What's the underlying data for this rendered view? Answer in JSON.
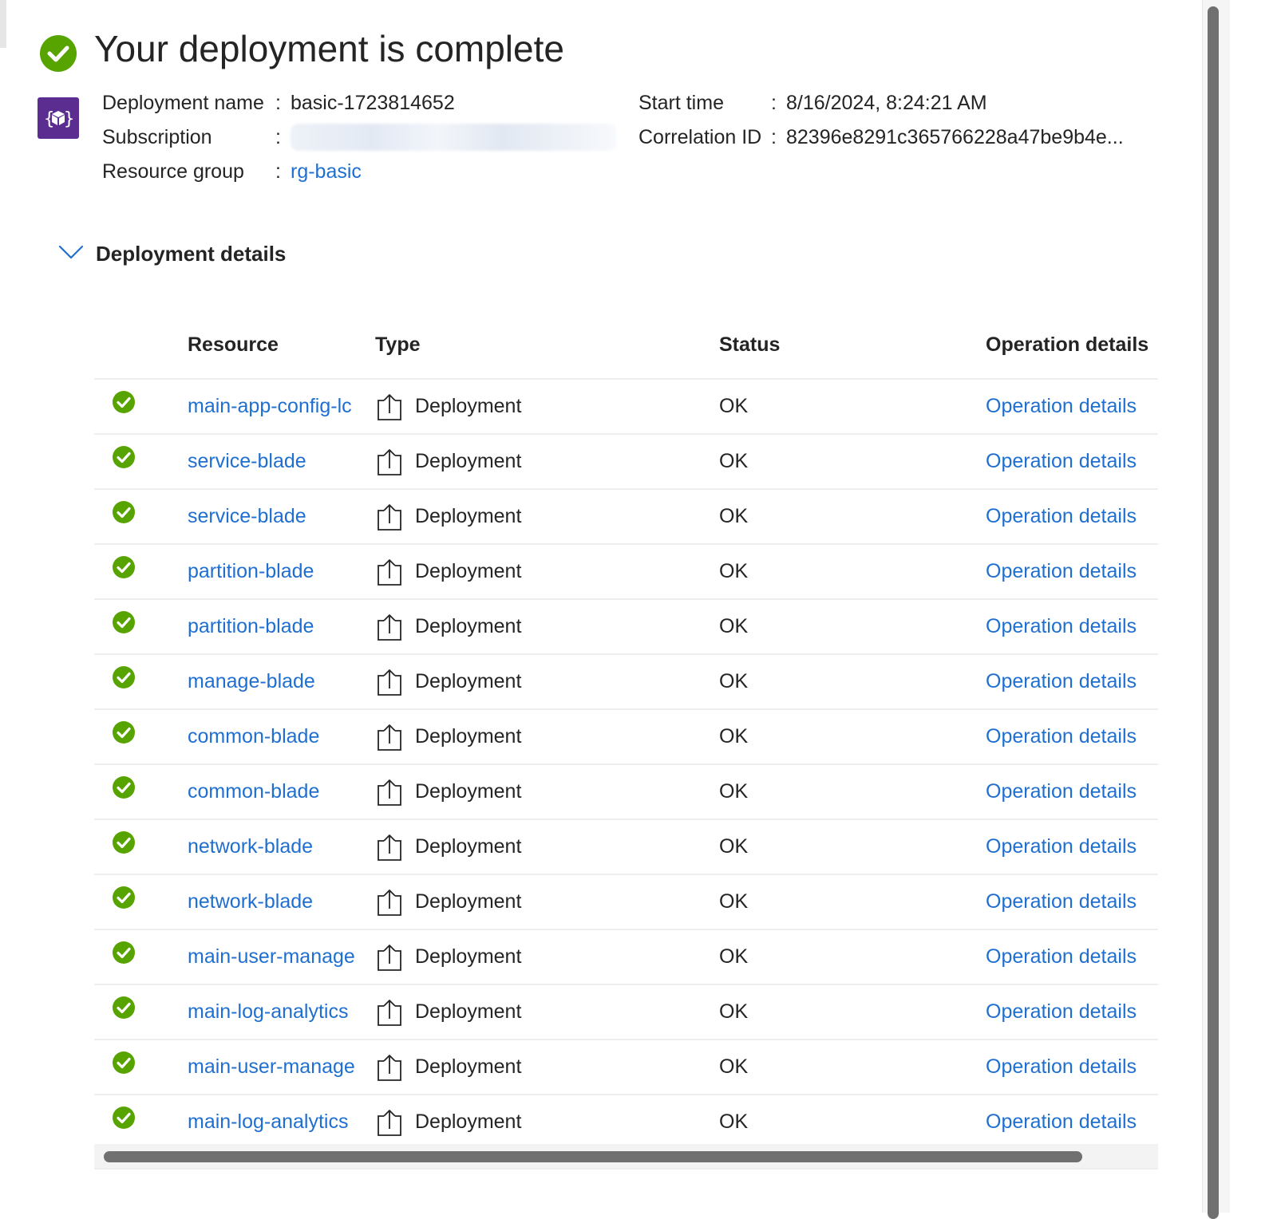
{
  "header": {
    "title": "Your deployment is complete",
    "status_icon": "check-circle-icon",
    "status_color": "#57a300"
  },
  "deployment_icon": {
    "name": "deployment-template-icon",
    "color": "#5c2d91"
  },
  "info": {
    "deployment_name_label": "Deployment name",
    "deployment_name_value": "basic-1723814652",
    "subscription_label": "Subscription",
    "subscription_value": "",
    "resource_group_label": "Resource group",
    "resource_group_value": "rg-basic",
    "start_time_label": "Start time",
    "start_time_value": "8/16/2024, 8:24:21 AM",
    "correlation_id_label": "Correlation ID",
    "correlation_id_value": "82396e8291c365766228a47be9b4e...",
    "separator": ":"
  },
  "details": {
    "title": "Deployment details",
    "expanded": true
  },
  "table": {
    "columns": [
      "Resource",
      "Type",
      "Status",
      "Operation details"
    ],
    "rows": [
      {
        "resource": "main-app-config-lc",
        "type": "Deployment",
        "status": "OK",
        "operation": "Operation details"
      },
      {
        "resource": "service-blade",
        "type": "Deployment",
        "status": "OK",
        "operation": "Operation details"
      },
      {
        "resource": "service-blade",
        "type": "Deployment",
        "status": "OK",
        "operation": "Operation details"
      },
      {
        "resource": "partition-blade",
        "type": "Deployment",
        "status": "OK",
        "operation": "Operation details"
      },
      {
        "resource": "partition-blade",
        "type": "Deployment",
        "status": "OK",
        "operation": "Operation details"
      },
      {
        "resource": "manage-blade",
        "type": "Deployment",
        "status": "OK",
        "operation": "Operation details"
      },
      {
        "resource": "common-blade",
        "type": "Deployment",
        "status": "OK",
        "operation": "Operation details"
      },
      {
        "resource": "common-blade",
        "type": "Deployment",
        "status": "OK",
        "operation": "Operation details"
      },
      {
        "resource": "network-blade",
        "type": "Deployment",
        "status": "OK",
        "operation": "Operation details"
      },
      {
        "resource": "network-blade",
        "type": "Deployment",
        "status": "OK",
        "operation": "Operation details"
      },
      {
        "resource": "main-user-manage",
        "type": "Deployment",
        "status": "OK",
        "operation": "Operation details"
      },
      {
        "resource": "main-log-analytics",
        "type": "Deployment",
        "status": "OK",
        "operation": "Operation details"
      },
      {
        "resource": "main-user-manage",
        "type": "Deployment",
        "status": "OK",
        "operation": "Operation details"
      },
      {
        "resource": "main-log-analytics",
        "type": "Deployment",
        "status": "OK",
        "operation": "Operation details"
      }
    ]
  },
  "colors": {
    "link": "#1f6fd0",
    "success": "#57a300",
    "text": "#242424"
  }
}
